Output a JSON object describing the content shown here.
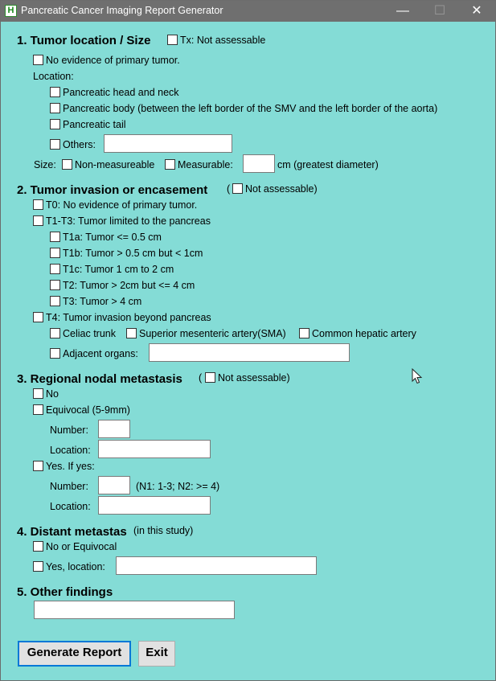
{
  "window": {
    "title": "Pancreatic Cancer Imaging Report Generator",
    "icon_letter": "H",
    "minimize_glyph": "—",
    "maximize_glyph": "☐",
    "close_glyph": "✕"
  },
  "s1": {
    "header": "1. Tumor location / Size",
    "tx": "Tx: Not assessable",
    "no_evidence": "No evidence of primary tumor.",
    "location_label": "Location:",
    "head_neck": "Pancreatic head and neck",
    "body": "Pancreatic body (between the left border of the SMV and the left border of the aorta)",
    "tail": "Pancreatic tail",
    "others": "Others:",
    "others_value": "",
    "size_label": "Size:",
    "non_measureable": "Non-measureable",
    "measurable": "Measurable:",
    "measurable_value": "",
    "cm_text": "cm (greatest diameter)"
  },
  "s2": {
    "header": "2. Tumor invasion or encasement",
    "not_assessable": "Not assessable)",
    "paren": "(",
    "t0": "T0: No evidence of primary tumor.",
    "t1t3": "T1-T3: Tumor limited to the pancreas",
    "t1a": "T1a: Tumor <= 0.5 cm",
    "t1b": "T1b: Tumor > 0.5 cm but < 1cm",
    "t1c": "T1c: Tumor 1 cm to 2 cm",
    "t2": "T2: Tumor > 2cm but <= 4 cm",
    "t3": "T3: Tumor > 4 cm",
    "t4": "T4: Tumor invasion beyond pancreas",
    "celiac": "Celiac trunk",
    "sma": "Superior mesenteric artery(SMA)",
    "cha": "Common hepatic artery",
    "adjacent": "Adjacent organs:",
    "adjacent_value": ""
  },
  "s3": {
    "header": "3. Regional nodal metastasis",
    "paren": "(",
    "not_assessable": "Not assessable)",
    "no": "No",
    "equivocal": "Equivocal (5-9mm)",
    "eq_number_label": "Number:",
    "eq_number_value": "",
    "eq_location_label": "Location:",
    "eq_location_value": "",
    "yes": "Yes. If yes:",
    "yes_number_label": "Number:",
    "yes_number_value": "",
    "n_hint": "(N1: 1-3; N2: >= 4)",
    "yes_location_label": "Location:",
    "yes_location_value": ""
  },
  "s4": {
    "header": "4. Distant metastas",
    "note": "(in this study)",
    "no_equivocal": "No or Equivocal",
    "yes_location": "Yes, location:",
    "location_value": ""
  },
  "s5": {
    "header": "5. Other findings",
    "value": ""
  },
  "buttons": {
    "generate": "Generate Report",
    "exit": "Exit"
  }
}
